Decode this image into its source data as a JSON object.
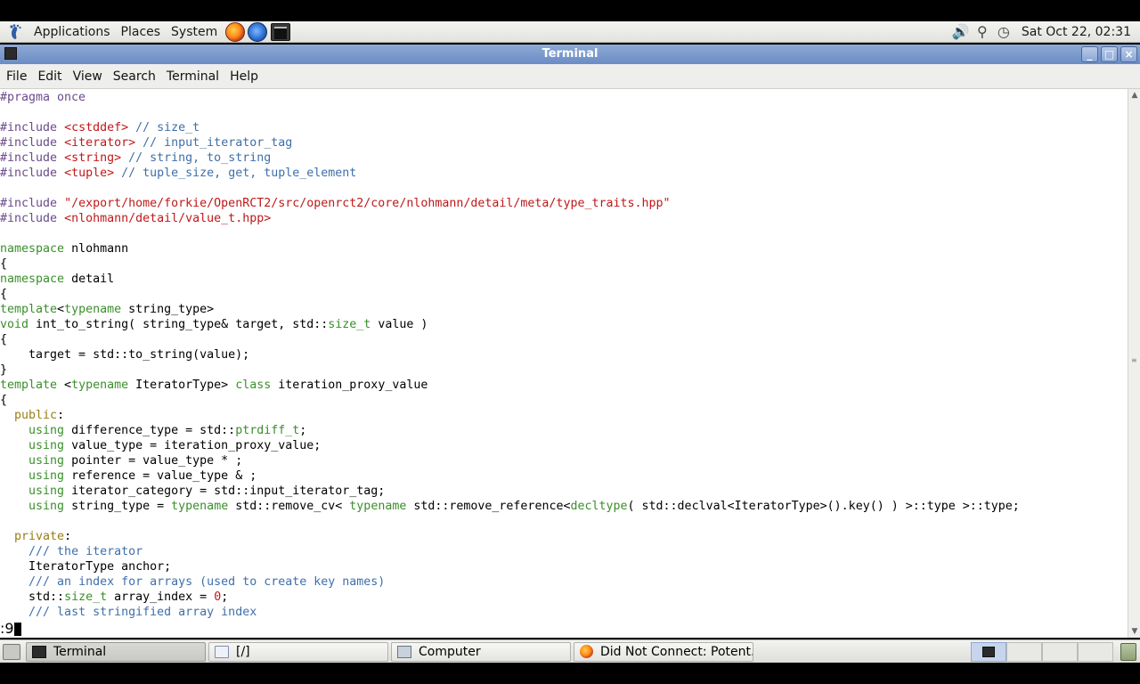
{
  "top_panel": {
    "menus": [
      "Applications",
      "Places",
      "System"
    ],
    "clock": "Sat Oct 22, 02:31"
  },
  "window": {
    "title": "Terminal",
    "buttons": [
      "_",
      "□",
      "×"
    ]
  },
  "menubar": [
    "File",
    "Edit",
    "View",
    "Search",
    "Terminal",
    "Help"
  ],
  "terminal": {
    "lines": [
      [
        [
          "k-pre",
          "#pragma once"
        ]
      ],
      [],
      [
        [
          "k-pre",
          "#include "
        ],
        [
          "k-str",
          "<cstddef>"
        ],
        [
          "k-com",
          " // size_t"
        ]
      ],
      [
        [
          "k-pre",
          "#include "
        ],
        [
          "k-str",
          "<iterator>"
        ],
        [
          "k-com",
          " // input_iterator_tag"
        ]
      ],
      [
        [
          "k-pre",
          "#include "
        ],
        [
          "k-str",
          "<string>"
        ],
        [
          "k-com",
          " // string, to_string"
        ]
      ],
      [
        [
          "k-pre",
          "#include "
        ],
        [
          "k-str",
          "<tuple>"
        ],
        [
          "k-com",
          " // tuple_size, get, tuple_element"
        ]
      ],
      [],
      [
        [
          "k-pre",
          "#include "
        ],
        [
          "k-str",
          "\"/export/home/forkie/OpenRCT2/src/openrct2/core/nlohmann/detail/meta/type_traits.hpp\""
        ]
      ],
      [
        [
          "k-pre",
          "#include "
        ],
        [
          "k-str",
          "<nlohmann/detail/value_t.hpp>"
        ]
      ],
      [],
      [
        [
          "k-ty",
          "namespace"
        ],
        [
          "",
          " nlohmann"
        ]
      ],
      [
        [
          "",
          "{"
        ]
      ],
      [
        [
          "k-ty",
          "namespace"
        ],
        [
          "",
          " detail"
        ]
      ],
      [
        [
          "",
          "{"
        ]
      ],
      [
        [
          "k-ty",
          "template"
        ],
        [
          "",
          "<"
        ],
        [
          "k-ty",
          "typename"
        ],
        [
          "",
          " string_type>"
        ]
      ],
      [
        [
          "k-ty",
          "void"
        ],
        [
          "",
          " int_to_string( string_type& target, std::"
        ],
        [
          "k-ty",
          "size_t"
        ],
        [
          "",
          " value )"
        ]
      ],
      [
        [
          "",
          "{"
        ]
      ],
      [
        [
          "",
          "    target = std::to_string(value);"
        ]
      ],
      [
        [
          "",
          "}"
        ]
      ],
      [
        [
          "k-ty",
          "template"
        ],
        [
          "",
          " <"
        ],
        [
          "k-ty",
          "typename"
        ],
        [
          "",
          " IteratorType> "
        ],
        [
          "k-ty",
          "class"
        ],
        [
          "",
          " iteration_proxy_value"
        ]
      ],
      [
        [
          "",
          "{"
        ]
      ],
      [
        [
          "",
          "  "
        ],
        [
          "k-kw",
          "public"
        ],
        [
          "",
          ":"
        ]
      ],
      [
        [
          "",
          "    "
        ],
        [
          "k-ty",
          "using"
        ],
        [
          "",
          " difference_type = std::"
        ],
        [
          "k-ty",
          "ptrdiff_t"
        ],
        [
          "",
          ";"
        ]
      ],
      [
        [
          "",
          "    "
        ],
        [
          "k-ty",
          "using"
        ],
        [
          "",
          " value_type = iteration_proxy_value;"
        ]
      ],
      [
        [
          "",
          "    "
        ],
        [
          "k-ty",
          "using"
        ],
        [
          "",
          " pointer = value_type * ;"
        ]
      ],
      [
        [
          "",
          "    "
        ],
        [
          "k-ty",
          "using"
        ],
        [
          "",
          " reference = value_type & ;"
        ]
      ],
      [
        [
          "",
          "    "
        ],
        [
          "k-ty",
          "using"
        ],
        [
          "",
          " iterator_category = std::input_iterator_tag;"
        ]
      ],
      [
        [
          "",
          "    "
        ],
        [
          "k-ty",
          "using"
        ],
        [
          "",
          " string_type = "
        ],
        [
          "k-ty",
          "typename"
        ],
        [
          "",
          " std::remove_cv< "
        ],
        [
          "k-ty",
          "typename"
        ],
        [
          "",
          " std::remove_reference<"
        ],
        [
          "k-ty",
          "decltype"
        ],
        [
          "",
          "( std::declval<IteratorType>().key() ) >::type >::type;"
        ]
      ],
      [],
      [
        [
          "",
          "  "
        ],
        [
          "k-kw",
          "private"
        ],
        [
          "",
          ":"
        ]
      ],
      [
        [
          "",
          "    "
        ],
        [
          "k-com",
          "/// the iterator"
        ]
      ],
      [
        [
          "",
          "    IteratorType anchor;"
        ]
      ],
      [
        [
          "",
          "    "
        ],
        [
          "k-com",
          "/// an index for arrays (used to create key names)"
        ]
      ],
      [
        [
          "",
          "    std::"
        ],
        [
          "k-ty",
          "size_t"
        ],
        [
          "",
          " array_index = "
        ],
        [
          "k-num",
          "0"
        ],
        [
          "",
          ";"
        ]
      ],
      [
        [
          "",
          "    "
        ],
        [
          "k-com",
          "/// last stringified array index"
        ]
      ]
    ],
    "command_line": ":9"
  },
  "taskbar": {
    "tasks": [
      {
        "label": "Terminal",
        "icon": "terminal-icon",
        "active": true
      },
      {
        "label": "[/]",
        "icon": "folder-icon",
        "active": false
      },
      {
        "label": "Computer",
        "icon": "computer-icon",
        "active": false
      },
      {
        "label": "Did Not Connect: Potent...",
        "icon": "firefox-icon",
        "active": false
      }
    ]
  }
}
